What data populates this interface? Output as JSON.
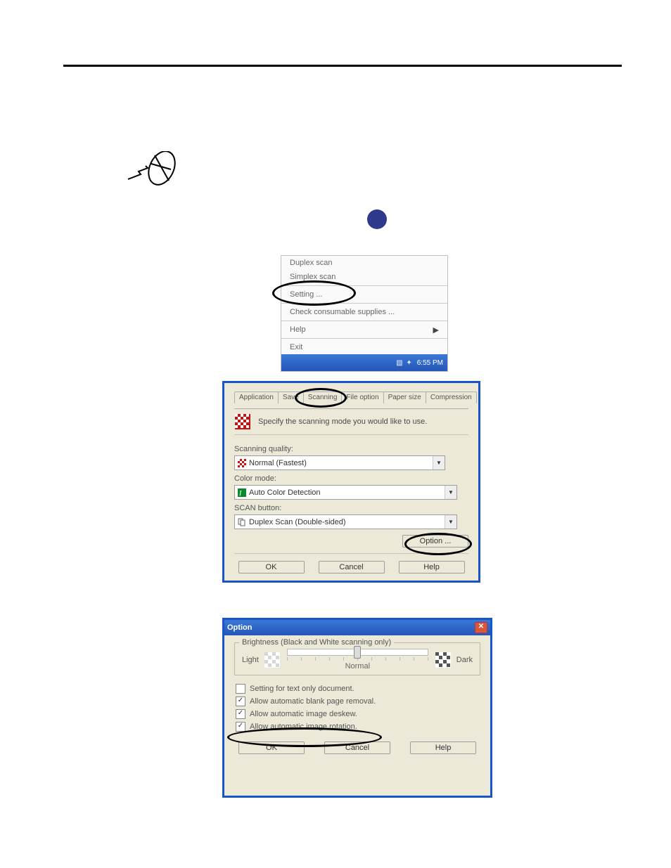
{
  "menu": {
    "duplex": "Duplex scan",
    "simplex": "Simplex scan",
    "setting": "Setting ...",
    "consumables": "Check consumable supplies ...",
    "help": "Help",
    "exit": "Exit",
    "clock": "6:55 PM"
  },
  "dlg": {
    "tabs": {
      "app": "Application",
      "save": "Save",
      "scanning": "Scanning",
      "fileopt": "File option",
      "paper": "Paper size",
      "comp": "Compression"
    },
    "spec": "Specify the scanning mode you would like to use.",
    "qlabel": "Scanning quality:",
    "qvalue": "Normal (Fastest)",
    "clabel": "Color mode:",
    "cvalue": "Auto Color Detection",
    "blabel": "SCAN button:",
    "bvalue": "Duplex Scan (Double-sided)",
    "option_btn": "Option ..."
  },
  "opt": {
    "title": "Option",
    "bright_title": "Brightness (Black and White scanning only)",
    "light": "Light",
    "dark": "Dark",
    "normal": "Normal",
    "c_textonly": "Setting for text only document.",
    "c_blank": "Allow automatic blank page removal.",
    "c_deskew": "Allow automatic image deskew.",
    "c_rotate": "Allow automatic image rotation."
  },
  "common": {
    "ok": "OK",
    "cancel": "Cancel",
    "help": "Help"
  }
}
